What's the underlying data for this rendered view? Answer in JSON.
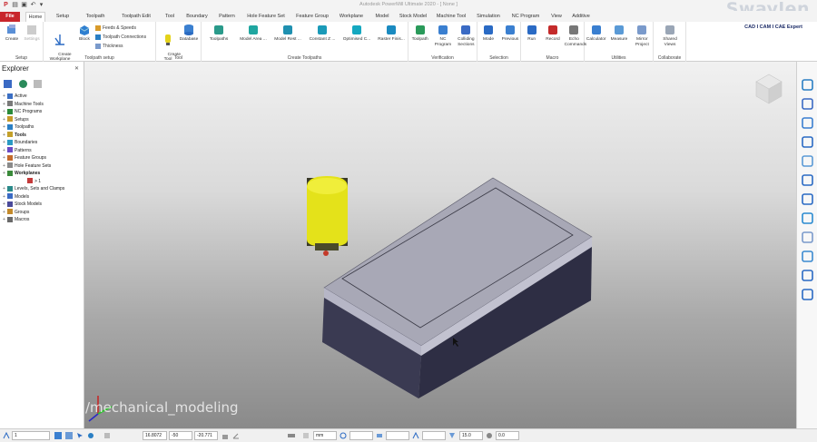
{
  "app": {
    "title": "Autodesk PowerMill Ultimate 2020 - [ None ]",
    "brand_watermark": "Swaylen",
    "cad_tagline": "CAD I CAM I CAE Expert",
    "overlay_watermark": "/mechanical_modeling"
  },
  "tabs": [
    {
      "label": "File",
      "kind": "file"
    },
    {
      "label": "Home",
      "kind": "active"
    },
    {
      "label": "Setup"
    },
    {
      "label": "Toolpath"
    },
    {
      "label": "Toolpath Edit"
    },
    {
      "label": "Tool"
    },
    {
      "label": "Boundary"
    },
    {
      "label": "Pattern"
    },
    {
      "label": "Hole Feature Set"
    },
    {
      "label": "Feature Group"
    },
    {
      "label": "Workplane"
    },
    {
      "label": "Model"
    },
    {
      "label": "Stock Model"
    },
    {
      "label": "Machine Tool"
    },
    {
      "label": "Simulation"
    },
    {
      "label": "NC Program"
    },
    {
      "label": "View"
    },
    {
      "label": "Additive"
    }
  ],
  "ribbon": {
    "setup": {
      "label": "Setup",
      "create": "Create",
      "settings": "Settings"
    },
    "toolpath_setup": {
      "label": "Toolpath setup",
      "create_workplane": "Create\nWorkplane",
      "block": "Block",
      "feeds_speeds": "Feeds & Speeds",
      "toolpath_connections": "Toolpath Connections",
      "thickness": "Thickness"
    },
    "tool": {
      "label": "Tool",
      "create_tool": "Create\nTool",
      "database": "Database"
    },
    "create_toolpaths": {
      "label": "Create Toolpaths",
      "items": [
        "Toolpaths",
        "Model Area ...",
        "Model Rest ...",
        "Constant Z ...",
        "Optimised C...",
        "Raster Finis..."
      ]
    },
    "verification": {
      "label": "Verification",
      "items": [
        "Toolpath",
        "NC\nProgram",
        "Colliding\nSections"
      ]
    },
    "selection": {
      "label": "Selection",
      "items": [
        "Mode",
        "Previous"
      ]
    },
    "macro": {
      "label": "Macro",
      "items": [
        "Run",
        "Record",
        "Echo\nCommands"
      ]
    },
    "utilities": {
      "label": "Utilities",
      "items": [
        "Calculator",
        "Measure",
        "Mirror\nProject"
      ]
    },
    "collaborate": {
      "label": "Collaborate",
      "items": [
        "Shared\nViews"
      ]
    }
  },
  "explorer": {
    "title": "Explorer",
    "tree": [
      {
        "label": "Active",
        "icon": "active-icon",
        "color": "#3b6fc4"
      },
      {
        "label": "Machine Tools",
        "icon": "machine-tools-icon",
        "color": "#7a7a7a"
      },
      {
        "label": "NC Programs",
        "icon": "nc-programs-icon",
        "color": "#2a8a3a"
      },
      {
        "label": "Setups",
        "icon": "setups-icon",
        "color": "#c79a2a"
      },
      {
        "label": "Toolpaths",
        "icon": "toolpaths-icon",
        "color": "#2a7fc4"
      },
      {
        "label": "Tools",
        "icon": "tools-icon",
        "color": "#c4a02a",
        "bold": true
      },
      {
        "label": "Boundaries",
        "icon": "boundaries-icon",
        "color": "#2a9ac4"
      },
      {
        "label": "Patterns",
        "icon": "patterns-icon",
        "color": "#6a4ac4"
      },
      {
        "label": "Feature Groups",
        "icon": "feature-groups-icon",
        "color": "#c46a2a"
      },
      {
        "label": "Hole Feature Sets",
        "icon": "hole-feature-sets-icon",
        "color": "#8a8a8a"
      },
      {
        "label": "Workplanes",
        "icon": "workplanes-icon",
        "color": "#3a8a3a",
        "bold": true
      },
      {
        "label": "> 1",
        "icon": "workplane-1-icon",
        "color": "#c43a3a",
        "indent": true
      },
      {
        "label": "Levels, Sets and Clamps",
        "icon": "levels-icon",
        "color": "#2a8a8a"
      },
      {
        "label": "Models",
        "icon": "models-icon",
        "color": "#3a6ac4"
      },
      {
        "label": "Stock Models",
        "icon": "stock-models-icon",
        "color": "#4a4a9a"
      },
      {
        "label": "Groups",
        "icon": "groups-icon",
        "color": "#c48a2a"
      },
      {
        "label": "Macros",
        "icon": "macros-icon",
        "color": "#6a6a6a"
      }
    ]
  },
  "statusbar": {
    "workplane_select": "1",
    "x": "16.8072",
    "y": "-50",
    "z": "-20.771",
    "units": "mm",
    "value_a": "15.0",
    "value_b": "0.0"
  },
  "colors": {
    "file_tab": "#c8262c",
    "tool_yellow": "#e4e21a",
    "block_top": "#a8a8b6",
    "block_front": "#3a3a52",
    "block_side": "#2e2e44"
  }
}
